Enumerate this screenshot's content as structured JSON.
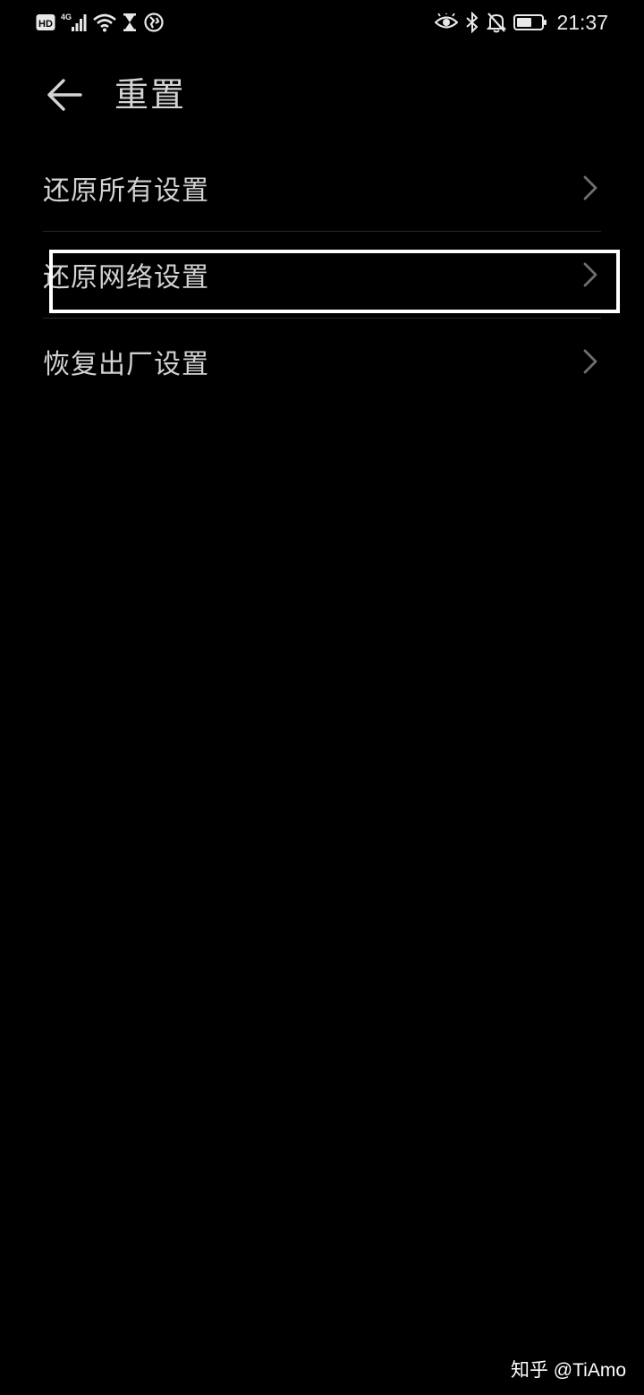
{
  "status_bar": {
    "left_icons": [
      "hd-icon",
      "signal-4g-icon",
      "wifi-icon",
      "hourglass-icon",
      "vpn-globe-icon"
    ],
    "network_type": "4G",
    "hd_label": "HD",
    "right_icons": [
      "eye-comfort-icon",
      "bluetooth-icon",
      "notifications-muted-icon",
      "battery-icon"
    ],
    "time": "21:37"
  },
  "header": {
    "title": "重置",
    "back_icon": "arrow-left-icon"
  },
  "list": {
    "items": [
      {
        "label": "还原所有设置",
        "icon": "chevron-right-icon"
      },
      {
        "label": "还原网络设置",
        "icon": "chevron-right-icon",
        "highlighted": true
      },
      {
        "label": "恢复出厂设置",
        "icon": "chevron-right-icon"
      }
    ]
  },
  "watermark": "知乎 @TiAmo",
  "colors": {
    "background": "#000000",
    "text": "#d2d2d2",
    "divider": "#262626",
    "highlight_border": "#ffffff"
  }
}
